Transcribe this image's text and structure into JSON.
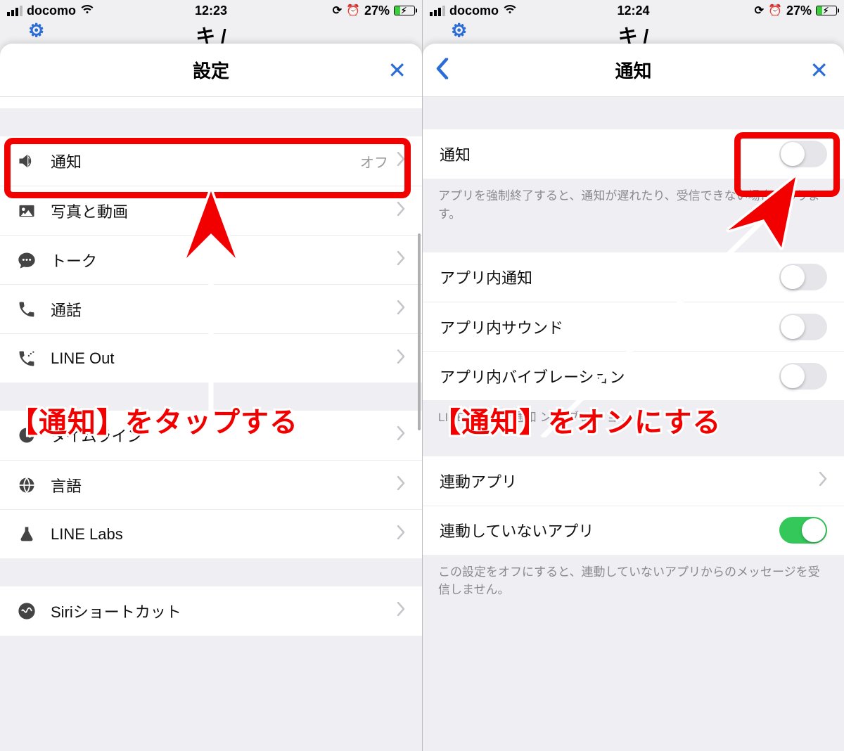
{
  "left": {
    "status": {
      "carrier": "docomo",
      "time": "12:23",
      "battery": "27%"
    },
    "bg_title": "キ /",
    "nav_title": "設定",
    "rows": [
      {
        "key": "notification",
        "label": "通知",
        "value": "オフ",
        "icon": "speaker"
      },
      {
        "key": "photos",
        "label": "写真と動画",
        "icon": "image"
      },
      {
        "key": "talk",
        "label": "トーク",
        "icon": "chat"
      },
      {
        "key": "calls",
        "label": "通話",
        "icon": "phone"
      },
      {
        "key": "lineout",
        "label": "LINE Out",
        "icon": "phone-out"
      },
      {
        "key": "timeline",
        "label": "タイムライン",
        "icon": "clock"
      },
      {
        "key": "language",
        "label": "言語",
        "icon": "globe"
      },
      {
        "key": "labs",
        "label": "LINE Labs",
        "icon": "flask"
      },
      {
        "key": "siri",
        "label": "Siriショートカット",
        "icon": "siri"
      }
    ],
    "caption": "【通知】をタップする"
  },
  "right": {
    "status": {
      "carrier": "docomo",
      "time": "12:24",
      "battery": "27%"
    },
    "bg_title": "キ /",
    "nav_title": "通知",
    "main_toggle": {
      "label": "通知",
      "on": false
    },
    "note1": "アプリを強制終了すると、通知が遅れたり、受信できない場合があります。",
    "toggles": [
      {
        "key": "inapp_notif",
        "label": "アプリ内通知",
        "on": false
      },
      {
        "key": "inapp_sound",
        "label": "アプリ内サウンド",
        "on": false
      },
      {
        "key": "inapp_vib",
        "label": "アプリ内バイブレーション",
        "on": false
      }
    ],
    "note_mid": "LINEアプリを通知                ンド               ブレー       ョ …",
    "linked_row": {
      "label": "連動アプリ"
    },
    "unlinked_toggle": {
      "label": "連動していないアプリ",
      "on": true
    },
    "note2": "この設定をオフにすると、連動していないアプリからのメッセージを受信しません。",
    "caption": "【通知】をオンにする"
  }
}
